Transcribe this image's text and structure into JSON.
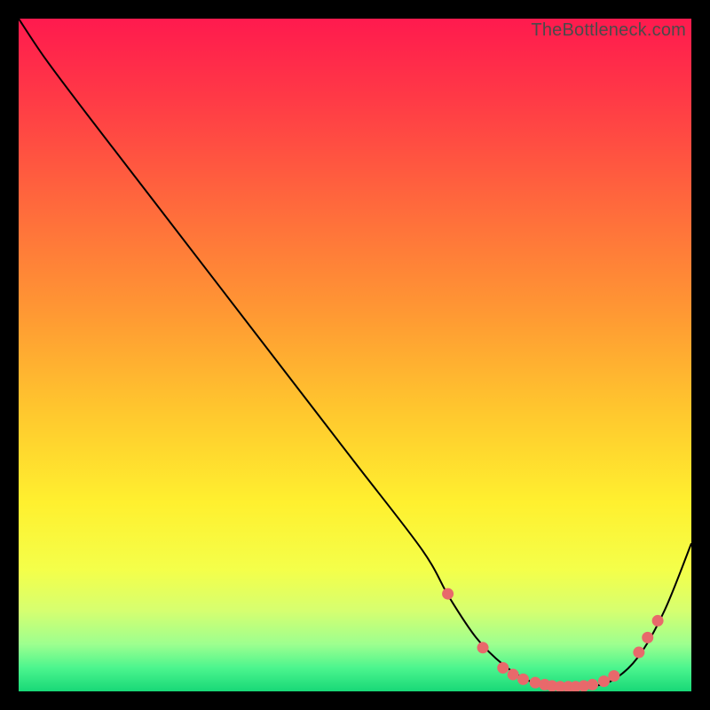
{
  "watermark": "TheBottleneck.com",
  "chart_data": {
    "type": "line",
    "title": "",
    "xlabel": "",
    "ylabel": "",
    "xlim": [
      0,
      100
    ],
    "ylim": [
      0,
      100
    ],
    "grid": false,
    "series": [
      {
        "name": "curve",
        "x": [
          0,
          4,
          10,
          20,
          30,
          40,
          50,
          60,
          64,
          68,
          72,
          76,
          80,
          84,
          88,
          92,
          96,
          100
        ],
        "y": [
          100,
          94,
          86,
          73,
          60,
          47,
          34,
          21,
          14,
          8,
          4,
          1.5,
          0.7,
          0.7,
          1.5,
          5,
          12,
          22
        ],
        "color": "#000000",
        "stroke_width": 2
      }
    ],
    "markers": {
      "name": "bottom-dots",
      "color": "#e8696b",
      "radius": 6.5,
      "points": [
        {
          "x": 63.8,
          "y": 14.5
        },
        {
          "x": 69.0,
          "y": 6.5
        },
        {
          "x": 72.0,
          "y": 3.5
        },
        {
          "x": 73.5,
          "y": 2.5
        },
        {
          "x": 75.0,
          "y": 1.8
        },
        {
          "x": 76.8,
          "y": 1.3
        },
        {
          "x": 78.2,
          "y": 1.0
        },
        {
          "x": 79.3,
          "y": 0.8
        },
        {
          "x": 80.5,
          "y": 0.7
        },
        {
          "x": 81.7,
          "y": 0.7
        },
        {
          "x": 82.8,
          "y": 0.7
        },
        {
          "x": 84.0,
          "y": 0.8
        },
        {
          "x": 85.3,
          "y": 1.0
        },
        {
          "x": 87.0,
          "y": 1.5
        },
        {
          "x": 88.5,
          "y": 2.3
        },
        {
          "x": 92.2,
          "y": 5.8
        },
        {
          "x": 93.5,
          "y": 8.0
        },
        {
          "x": 95.0,
          "y": 10.5
        }
      ]
    },
    "background_gradient": {
      "stops": [
        {
          "offset": 0.0,
          "color": "#ff1a4e"
        },
        {
          "offset": 0.12,
          "color": "#ff3a46"
        },
        {
          "offset": 0.28,
          "color": "#ff6a3c"
        },
        {
          "offset": 0.44,
          "color": "#ff9933"
        },
        {
          "offset": 0.58,
          "color": "#ffc62e"
        },
        {
          "offset": 0.72,
          "color": "#fff02f"
        },
        {
          "offset": 0.82,
          "color": "#f4ff4a"
        },
        {
          "offset": 0.88,
          "color": "#d6ff70"
        },
        {
          "offset": 0.93,
          "color": "#9dff8f"
        },
        {
          "offset": 0.965,
          "color": "#4cf58e"
        },
        {
          "offset": 1.0,
          "color": "#18d877"
        }
      ]
    }
  }
}
